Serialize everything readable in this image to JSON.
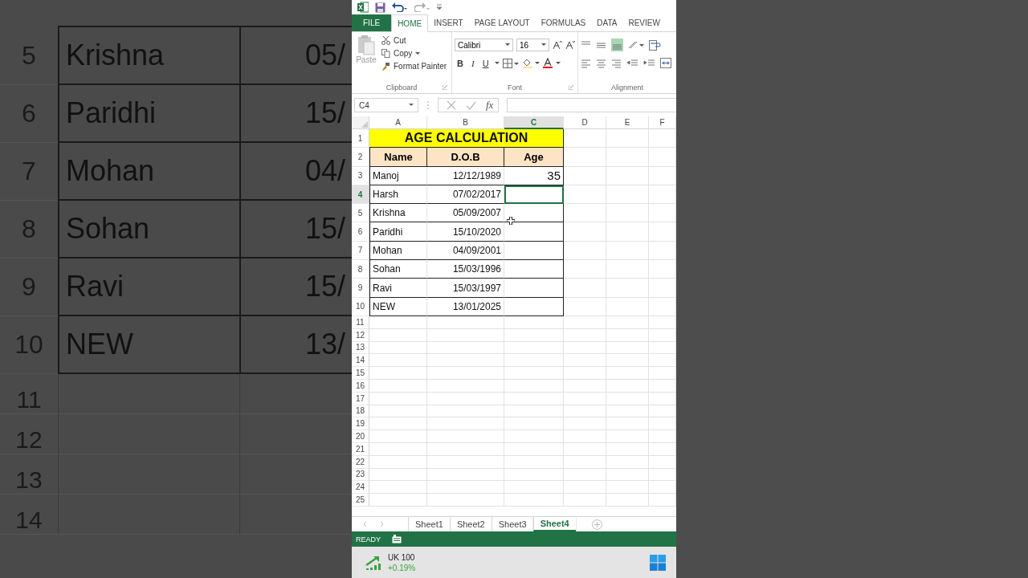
{
  "backdrop": {
    "rows": [
      {
        "number": "5",
        "name": "Krishna",
        "dob": "05/"
      },
      {
        "number": "6",
        "name": "Paridhi",
        "dob": "15/"
      },
      {
        "number": "7",
        "name": "Mohan",
        "dob": "04/"
      },
      {
        "number": "8",
        "name": "Sohan",
        "dob": "15/"
      },
      {
        "number": "9",
        "name": "Ravi",
        "dob": "15/"
      },
      {
        "number": "10",
        "name": "NEW",
        "dob": "13/"
      }
    ],
    "empty_rows": [
      "11",
      "12",
      "13",
      "14"
    ]
  },
  "ribbon": {
    "tabs": [
      {
        "label": "FILE",
        "kind": "file",
        "selected": false
      },
      {
        "label": "HOME",
        "kind": "tab",
        "selected": true
      },
      {
        "label": "INSERT",
        "kind": "tab",
        "selected": false
      },
      {
        "label": "PAGE LAYOUT",
        "kind": "tab",
        "selected": false
      },
      {
        "label": "FORMULAS",
        "kind": "tab",
        "selected": false
      },
      {
        "label": "DATA",
        "kind": "tab",
        "selected": false
      },
      {
        "label": "REVIEW",
        "kind": "tab",
        "selected": false
      }
    ],
    "clipboard": {
      "paste": "Paste",
      "cut": "Cut",
      "copy": "Copy",
      "format_painter": "Format Painter",
      "group_label": "Clipboard"
    },
    "font": {
      "name": "Calibri",
      "size": "16",
      "bold": "B",
      "italic": "I",
      "underline": "U",
      "group_label": "Font"
    },
    "alignment": {
      "group_label": "Alignment"
    }
  },
  "formula_bar": {
    "name_box": "C4",
    "fx": "fx"
  },
  "sheet": {
    "columns": [
      {
        "label": "A",
        "selected": false
      },
      {
        "label": "B",
        "selected": false
      },
      {
        "label": "C",
        "selected": true
      },
      {
        "label": "D",
        "selected": false
      },
      {
        "label": "E",
        "selected": false
      },
      {
        "label": "F",
        "selected": false
      }
    ],
    "title_row": "1",
    "title": "AGE CALCULATION",
    "header_row": "2",
    "headers": [
      "Name",
      "D.O.B",
      "Age"
    ],
    "rows": [
      {
        "number": "3",
        "name": "Manoj",
        "dob": "12/12/1989",
        "age": "35",
        "selected": false
      },
      {
        "number": "4",
        "name": "Harsh",
        "dob": "07/02/2017",
        "selected": true
      },
      {
        "number": "5",
        "name": "Krishna",
        "dob": "05/09/2007",
        "selected": false
      },
      {
        "number": "6",
        "name": "Paridhi",
        "dob": "15/10/2020",
        "selected": false
      },
      {
        "number": "7",
        "name": "Mohan",
        "dob": "04/09/2001",
        "selected": false
      },
      {
        "number": "8",
        "name": "Sohan",
        "dob": "15/03/1996",
        "selected": false
      },
      {
        "number": "9",
        "name": "Ravi",
        "dob": "15/03/1997",
        "selected": false
      },
      {
        "number": "10",
        "name": "NEW",
        "dob": "13/01/2025",
        "selected": false
      }
    ],
    "empty_rows": [
      "11",
      "12",
      "13",
      "14",
      "15",
      "16",
      "17",
      "18",
      "19",
      "20",
      "21",
      "22",
      "23",
      "24",
      "25"
    ]
  },
  "sheet_tabs": [
    {
      "label": "Sheet1",
      "selected": false
    },
    {
      "label": "Sheet2",
      "selected": false
    },
    {
      "label": "Sheet3",
      "selected": false
    },
    {
      "label": "Sheet4",
      "selected": true
    }
  ],
  "status_bar": {
    "mode": "READY"
  },
  "taskbar": {
    "ticker": "UK 100",
    "change": "+0.19%"
  }
}
